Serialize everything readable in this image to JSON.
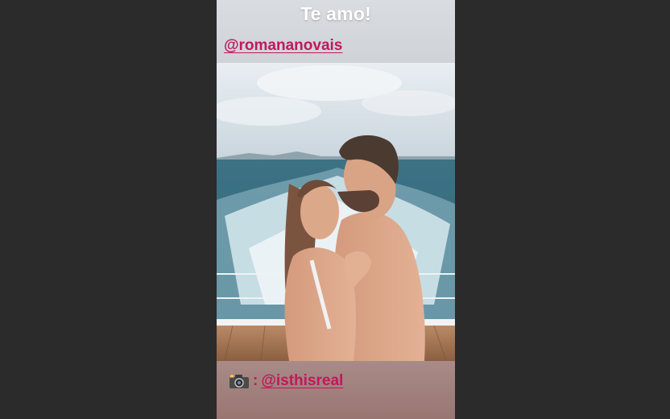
{
  "story": {
    "caption": "Te amo!",
    "mention": "@romananovais",
    "photo_credit": {
      "icon": "camera-icon",
      "separator": ":",
      "handle": "@isthisreal"
    }
  },
  "colors": {
    "side_background": "#2b2b2b",
    "mention_color": "#c2185b"
  }
}
